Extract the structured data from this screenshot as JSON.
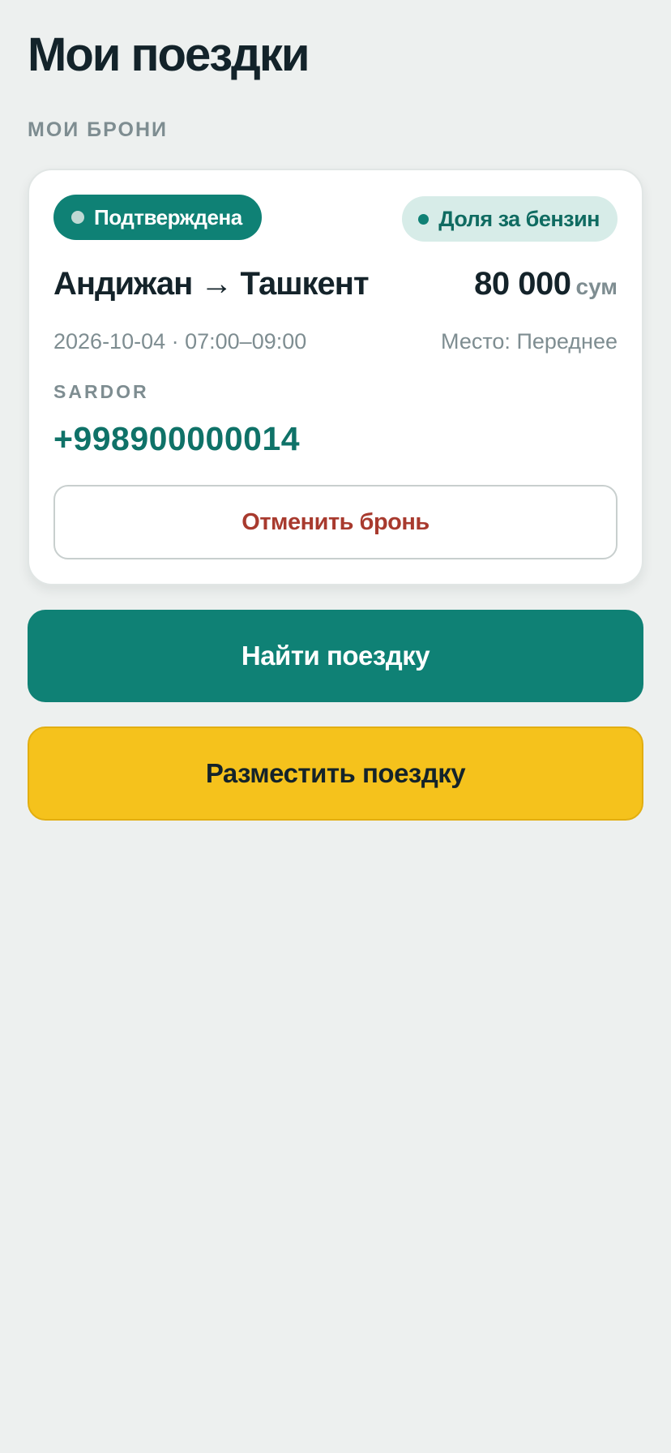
{
  "header": {
    "title": "Мои поездки"
  },
  "bookings_section": {
    "label": "МОИ БРОНИ"
  },
  "booking": {
    "status": "Подтверждена",
    "share_badge": "Доля за бензин",
    "route": "Андижан → Ташкент",
    "price": "80 000",
    "currency": "сум",
    "datetime": "2026-10-04 · 07:00–09:00",
    "seat": "Место: Переднее",
    "driver_name": "SARDOR",
    "driver_phone": "+998900000014",
    "cancel_label": "Отменить бронь"
  },
  "actions": {
    "find_label": "Найти поездку",
    "post_label": "Разместить поездку"
  },
  "colors": {
    "background": "#edf0ef",
    "primary": "#0f8175",
    "accent": "#f5c21c",
    "danger": "#a83a2e",
    "muted": "#7e8d91"
  },
  "icons": {
    "status_dot": "dot-icon",
    "share_dot": "dot-icon"
  }
}
